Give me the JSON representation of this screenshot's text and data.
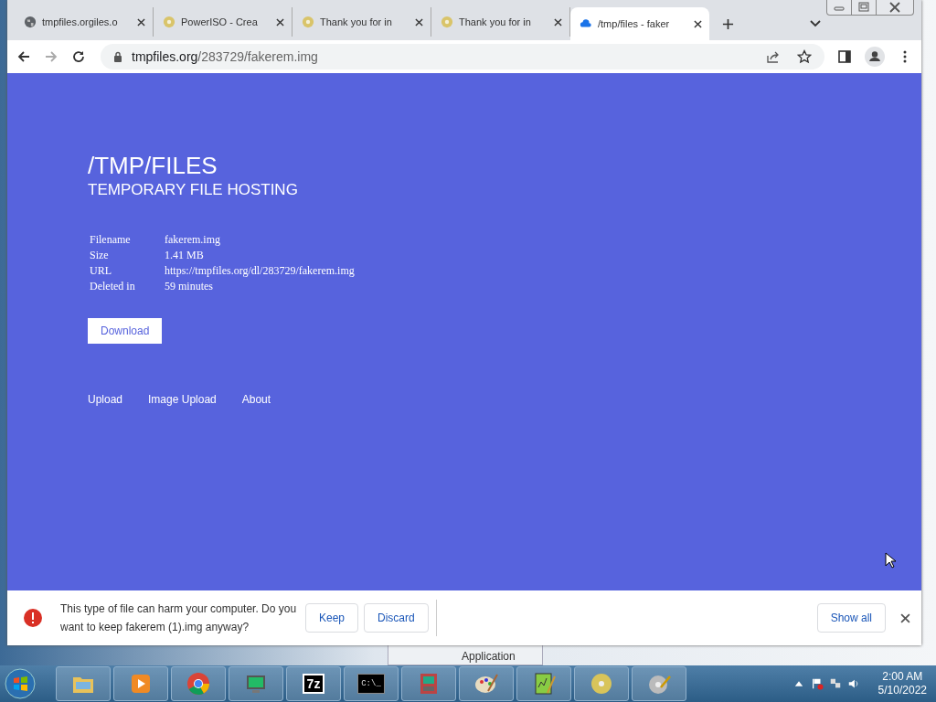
{
  "browser": {
    "tabs": [
      {
        "title": "tmpfiles.orgiles.o",
        "kind": "globe",
        "selected": false
      },
      {
        "title": "PowerISO - Crea",
        "kind": "disc",
        "selected": false
      },
      {
        "title": "Thank you for in",
        "kind": "disc",
        "selected": false
      },
      {
        "title": "Thank you for in",
        "kind": "disc",
        "selected": false
      },
      {
        "title": "/tmp/files - faker",
        "kind": "cloud",
        "selected": true
      }
    ],
    "address": {
      "host": "tmpfiles.org",
      "path": "/283729/fakerem.img"
    }
  },
  "page": {
    "title": "/TMP/FILES",
    "subtitle": "TEMPORARY FILE HOSTING",
    "details": [
      {
        "label": "Filename",
        "value": "fakerem.img"
      },
      {
        "label": "Size",
        "value": "1.41 MB"
      },
      {
        "label": "URL",
        "value": "https://tmpfiles.org/dl/283729/fakerem.img"
      },
      {
        "label": "Deleted in",
        "value": "59 minutes"
      }
    ],
    "download_button": "Download",
    "links": [
      "Upload",
      "Image Upload",
      "About"
    ]
  },
  "download_bar": {
    "warning": "This type of file can harm your computer. Do you want to keep fakerem (1).img anyway?",
    "buttons": [
      "Keep",
      "Discard"
    ],
    "show_all": "Show all"
  },
  "background_window": {
    "label": "Application"
  },
  "taskbar": {
    "apps": [
      {
        "kind": "folder"
      },
      {
        "kind": "media"
      },
      {
        "kind": "chrome"
      },
      {
        "kind": "monitor"
      },
      {
        "kind": "archive",
        "text": "7z"
      },
      {
        "kind": "terminal",
        "text": "C:\\_"
      },
      {
        "kind": "computer"
      },
      {
        "kind": "paint"
      },
      {
        "kind": "notepad"
      },
      {
        "kind": "disc"
      },
      {
        "kind": "disctool"
      }
    ],
    "time": "2:00 AM",
    "date": "5/10/2022"
  }
}
